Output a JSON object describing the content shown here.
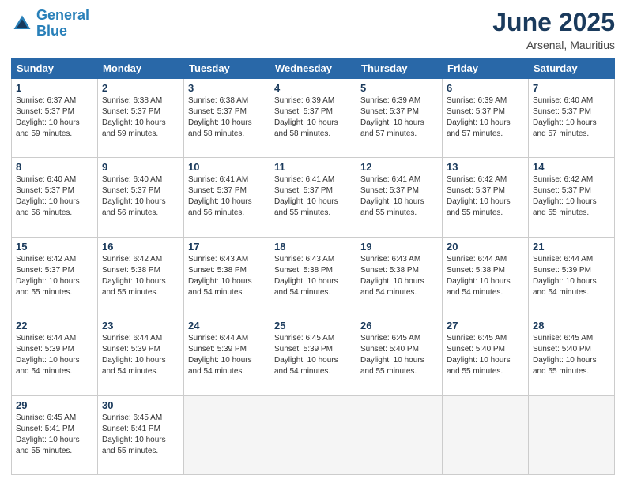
{
  "header": {
    "logo_line1": "General",
    "logo_line2": "Blue",
    "month_title": "June 2025",
    "location": "Arsenal, Mauritius"
  },
  "weekdays": [
    "Sunday",
    "Monday",
    "Tuesday",
    "Wednesday",
    "Thursday",
    "Friday",
    "Saturday"
  ],
  "weeks": [
    [
      {
        "day": "1",
        "info": "Sunrise: 6:37 AM\nSunset: 5:37 PM\nDaylight: 10 hours\nand 59 minutes."
      },
      {
        "day": "2",
        "info": "Sunrise: 6:38 AM\nSunset: 5:37 PM\nDaylight: 10 hours\nand 59 minutes."
      },
      {
        "day": "3",
        "info": "Sunrise: 6:38 AM\nSunset: 5:37 PM\nDaylight: 10 hours\nand 58 minutes."
      },
      {
        "day": "4",
        "info": "Sunrise: 6:39 AM\nSunset: 5:37 PM\nDaylight: 10 hours\nand 58 minutes."
      },
      {
        "day": "5",
        "info": "Sunrise: 6:39 AM\nSunset: 5:37 PM\nDaylight: 10 hours\nand 57 minutes."
      },
      {
        "day": "6",
        "info": "Sunrise: 6:39 AM\nSunset: 5:37 PM\nDaylight: 10 hours\nand 57 minutes."
      },
      {
        "day": "7",
        "info": "Sunrise: 6:40 AM\nSunset: 5:37 PM\nDaylight: 10 hours\nand 57 minutes."
      }
    ],
    [
      {
        "day": "8",
        "info": "Sunrise: 6:40 AM\nSunset: 5:37 PM\nDaylight: 10 hours\nand 56 minutes."
      },
      {
        "day": "9",
        "info": "Sunrise: 6:40 AM\nSunset: 5:37 PM\nDaylight: 10 hours\nand 56 minutes."
      },
      {
        "day": "10",
        "info": "Sunrise: 6:41 AM\nSunset: 5:37 PM\nDaylight: 10 hours\nand 56 minutes."
      },
      {
        "day": "11",
        "info": "Sunrise: 6:41 AM\nSunset: 5:37 PM\nDaylight: 10 hours\nand 55 minutes."
      },
      {
        "day": "12",
        "info": "Sunrise: 6:41 AM\nSunset: 5:37 PM\nDaylight: 10 hours\nand 55 minutes."
      },
      {
        "day": "13",
        "info": "Sunrise: 6:42 AM\nSunset: 5:37 PM\nDaylight: 10 hours\nand 55 minutes."
      },
      {
        "day": "14",
        "info": "Sunrise: 6:42 AM\nSunset: 5:37 PM\nDaylight: 10 hours\nand 55 minutes."
      }
    ],
    [
      {
        "day": "15",
        "info": "Sunrise: 6:42 AM\nSunset: 5:37 PM\nDaylight: 10 hours\nand 55 minutes."
      },
      {
        "day": "16",
        "info": "Sunrise: 6:42 AM\nSunset: 5:38 PM\nDaylight: 10 hours\nand 55 minutes."
      },
      {
        "day": "17",
        "info": "Sunrise: 6:43 AM\nSunset: 5:38 PM\nDaylight: 10 hours\nand 54 minutes."
      },
      {
        "day": "18",
        "info": "Sunrise: 6:43 AM\nSunset: 5:38 PM\nDaylight: 10 hours\nand 54 minutes."
      },
      {
        "day": "19",
        "info": "Sunrise: 6:43 AM\nSunset: 5:38 PM\nDaylight: 10 hours\nand 54 minutes."
      },
      {
        "day": "20",
        "info": "Sunrise: 6:44 AM\nSunset: 5:38 PM\nDaylight: 10 hours\nand 54 minutes."
      },
      {
        "day": "21",
        "info": "Sunrise: 6:44 AM\nSunset: 5:39 PM\nDaylight: 10 hours\nand 54 minutes."
      }
    ],
    [
      {
        "day": "22",
        "info": "Sunrise: 6:44 AM\nSunset: 5:39 PM\nDaylight: 10 hours\nand 54 minutes."
      },
      {
        "day": "23",
        "info": "Sunrise: 6:44 AM\nSunset: 5:39 PM\nDaylight: 10 hours\nand 54 minutes."
      },
      {
        "day": "24",
        "info": "Sunrise: 6:44 AM\nSunset: 5:39 PM\nDaylight: 10 hours\nand 54 minutes."
      },
      {
        "day": "25",
        "info": "Sunrise: 6:45 AM\nSunset: 5:39 PM\nDaylight: 10 hours\nand 54 minutes."
      },
      {
        "day": "26",
        "info": "Sunrise: 6:45 AM\nSunset: 5:40 PM\nDaylight: 10 hours\nand 55 minutes."
      },
      {
        "day": "27",
        "info": "Sunrise: 6:45 AM\nSunset: 5:40 PM\nDaylight: 10 hours\nand 55 minutes."
      },
      {
        "day": "28",
        "info": "Sunrise: 6:45 AM\nSunset: 5:40 PM\nDaylight: 10 hours\nand 55 minutes."
      }
    ],
    [
      {
        "day": "29",
        "info": "Sunrise: 6:45 AM\nSunset: 5:41 PM\nDaylight: 10 hours\nand 55 minutes."
      },
      {
        "day": "30",
        "info": "Sunrise: 6:45 AM\nSunset: 5:41 PM\nDaylight: 10 hours\nand 55 minutes."
      },
      {
        "day": "",
        "info": ""
      },
      {
        "day": "",
        "info": ""
      },
      {
        "day": "",
        "info": ""
      },
      {
        "day": "",
        "info": ""
      },
      {
        "day": "",
        "info": ""
      }
    ]
  ]
}
